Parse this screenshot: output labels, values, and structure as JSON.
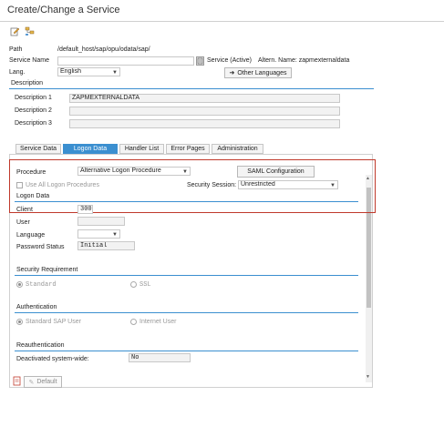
{
  "window": {
    "title": "Create/Change a Service"
  },
  "toolbar": {
    "icons": [
      "edit-icon",
      "hierarchy-icon"
    ]
  },
  "header": {
    "path_label": "Path",
    "path_value": "/default_host/sap/opu/odata/sap/",
    "service_name_label": "Service Name",
    "service_name_value": "",
    "service_status": "Service (Active)",
    "altern_name": "Altern. Name: zapmexternaldata",
    "lang_label": "Lang.",
    "lang_value": "English",
    "other_languages_button": "Other Languages"
  },
  "description": {
    "section_label": "Description",
    "rows": [
      {
        "label": "Description 1",
        "value": "ZAPMEXTERNALDATA"
      },
      {
        "label": "Description 2",
        "value": ""
      },
      {
        "label": "Description 3",
        "value": ""
      }
    ]
  },
  "tabs": [
    {
      "label": "Service Data",
      "active": false
    },
    {
      "label": "Logon Data",
      "active": true
    },
    {
      "label": "Handler List",
      "active": false
    },
    {
      "label": "Error Pages",
      "active": false
    },
    {
      "label": "Administration",
      "active": false
    }
  ],
  "logon": {
    "procedure_label": "Procedure",
    "procedure_value": "Alternative Logon Procedure",
    "saml_button": "SAML Configuration",
    "use_all_label": "Use All Logon Procedures",
    "security_session_label": "Security Session:",
    "security_session_value": "Unrestricted",
    "logon_data_section": "Logon Data",
    "client_label": "Client",
    "client_value": "300",
    "user_label": "User",
    "user_value": "",
    "language_label": "Language",
    "language_value": "",
    "password_status_label": "Password Status",
    "password_status_value": "Initial"
  },
  "security_requirement": {
    "section_label": "Security Requirement",
    "option_standard": "Standard",
    "option_ssl": "SSL"
  },
  "authentication": {
    "section_label": "Authentication",
    "option_standard_sap_user": "Standard SAP User",
    "option_internet_user": "Internet User"
  },
  "reauthentication": {
    "section_label": "Reauthentication",
    "deactivated_label": "Deactivated system-wide:",
    "deactivated_value": "No"
  },
  "footer": {
    "default_button": "Default"
  },
  "colors": {
    "accent": "#3b8fd0",
    "highlight_border": "#c0392b"
  }
}
